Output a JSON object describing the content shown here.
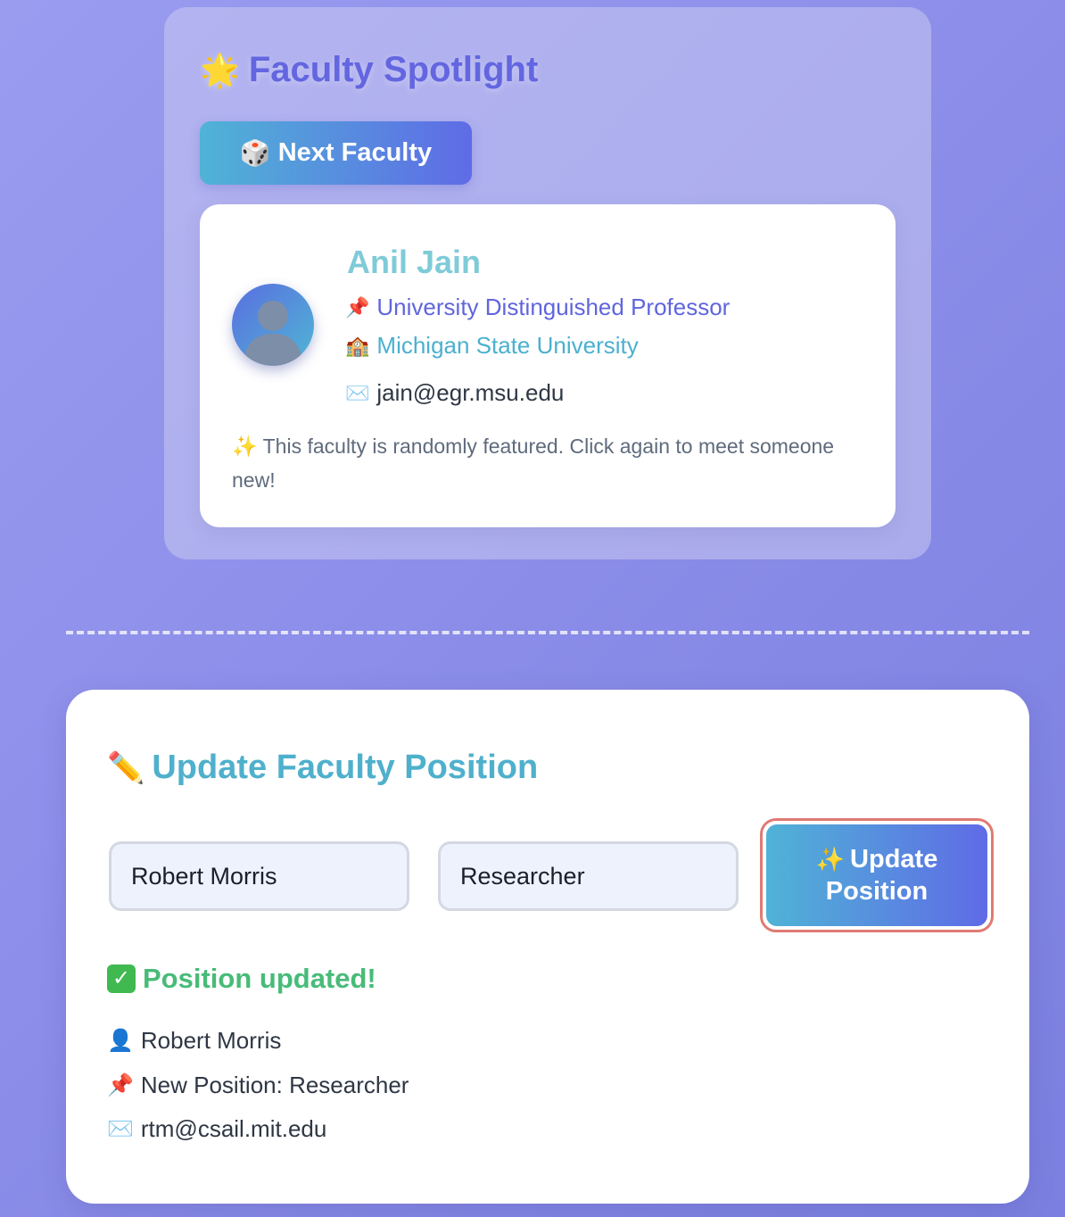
{
  "spotlight": {
    "title_icon": "🌟",
    "title": "Faculty Spotlight",
    "next_button": {
      "icon": "🎲",
      "label": "Next Faculty"
    },
    "faculty": {
      "avatar_icon": "user-silhouette-icon",
      "name": "Anil Jain",
      "title_icon": "📌",
      "title": "University Distinguished Professor",
      "university_icon": "🏫",
      "university": "Michigan State University",
      "email_icon": "✉️",
      "email": "jain@egr.msu.edu"
    },
    "note_icon": "✨",
    "note": "This faculty is randomly featured. Click again to meet someone new!"
  },
  "update": {
    "title_icon": "✏️",
    "title": "Update Faculty Position",
    "name_field": {
      "value": "Robert Morris",
      "placeholder": ""
    },
    "position_field": {
      "value": "Researcher",
      "placeholder": ""
    },
    "button": {
      "icon": "✨",
      "line1": "Update",
      "line2": "Position"
    },
    "result": {
      "status_icon": "✅",
      "status": "Position updated!",
      "name_icon": "👤",
      "name": "Robert Morris",
      "position_icon": "📌",
      "position": "New Position: Researcher",
      "email_icon": "✉️",
      "email": "rtm@csail.mit.edu"
    }
  },
  "colors": {
    "background": "#8a8ce8",
    "accent_purple": "#6366e0",
    "accent_teal": "#4fb0cc",
    "success_green": "#48bb78",
    "focus_ring": "#e07a73"
  }
}
